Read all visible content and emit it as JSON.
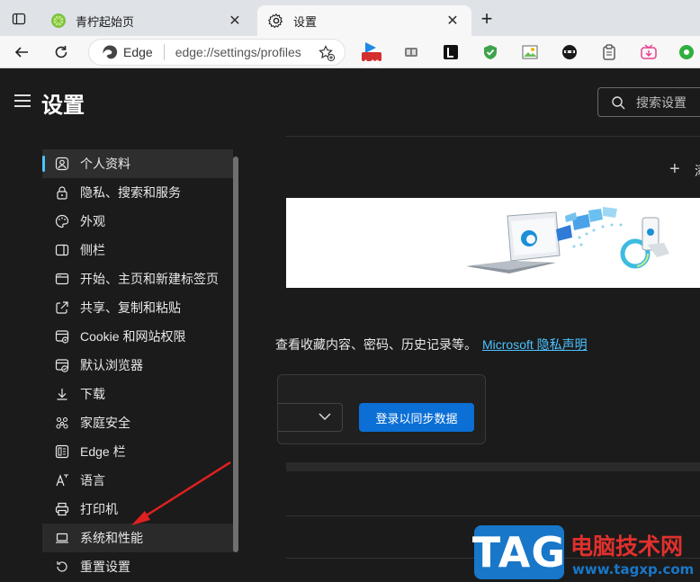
{
  "tabs": [
    {
      "title": "青柠起始页",
      "icon": "lime-icon",
      "active": false
    },
    {
      "title": "设置",
      "icon": "gear-icon",
      "active": true
    }
  ],
  "toolbar": {
    "site_label": "Edge",
    "url": "edge://settings/profiles",
    "zoom_badge": "1.00"
  },
  "sidebar": {
    "title": "设置",
    "items": [
      {
        "label": "个人资料",
        "icon": "profile-icon"
      },
      {
        "label": "隐私、搜索和服务",
        "icon": "lock-icon"
      },
      {
        "label": "外观",
        "icon": "palette-icon"
      },
      {
        "label": "侧栏",
        "icon": "sidebar-icon"
      },
      {
        "label": "开始、主页和新建标签页",
        "icon": "home-tab-icon"
      },
      {
        "label": "共享、复制和粘贴",
        "icon": "share-icon"
      },
      {
        "label": "Cookie 和网站权限",
        "icon": "cookie-icon"
      },
      {
        "label": "默认浏览器",
        "icon": "browser-icon"
      },
      {
        "label": "下载",
        "icon": "download-icon"
      },
      {
        "label": "家庭安全",
        "icon": "family-icon"
      },
      {
        "label": "Edge 栏",
        "icon": "edge-bar-icon"
      },
      {
        "label": "语言",
        "icon": "language-icon"
      },
      {
        "label": "打印机",
        "icon": "printer-icon"
      },
      {
        "label": "系统和性能",
        "icon": "laptop-icon"
      },
      {
        "label": "重置设置",
        "icon": "reset-icon"
      }
    ],
    "selected_index": 0,
    "highlighted_index": 13
  },
  "main": {
    "search_placeholder": "搜索设置",
    "add_profile_label": "添",
    "description": "查看收藏内容、密码、历史记录等。",
    "privacy_link": "Microsoft 隐私声明",
    "sync_button": "登录以同步数据"
  },
  "watermark": {
    "tag": "TAG",
    "site_name": "电脑技术网",
    "url": "www.tagxp.com"
  },
  "colors": {
    "accent": "#4cc2ff",
    "button_blue": "#0b6fd6",
    "arrow_red": "#e02020"
  }
}
